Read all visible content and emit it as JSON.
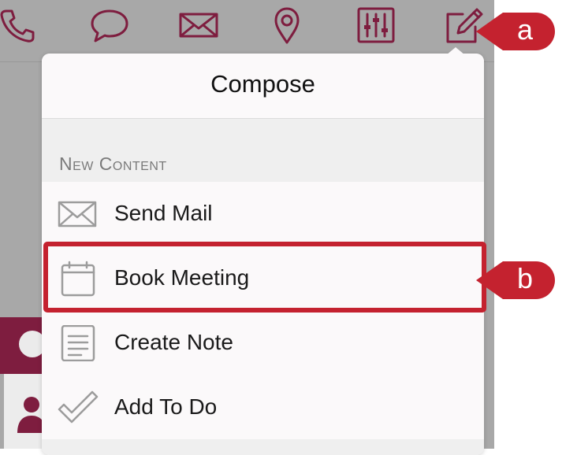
{
  "toolbar": {
    "icons": [
      "phone-icon",
      "chat-bubble-icon",
      "mail-icon",
      "location-pin-icon",
      "sliders-icon",
      "compose-icon"
    ]
  },
  "compose_popover": {
    "title": "Compose",
    "section_header": "New Content",
    "items": [
      {
        "label": "Send Mail",
        "icon": "mail-icon"
      },
      {
        "label": "Book Meeting",
        "icon": "calendar-icon"
      },
      {
        "label": "Create Note",
        "icon": "note-icon"
      },
      {
        "label": "Add To Do",
        "icon": "checkmark-icon"
      }
    ]
  },
  "annotations": {
    "a": "a",
    "b": "b"
  },
  "colors": {
    "brand": "#7e1d3f",
    "callout": "#c4222f",
    "toolbar_bg": "#a8a8a8",
    "section_text": "#7a7a7a"
  }
}
